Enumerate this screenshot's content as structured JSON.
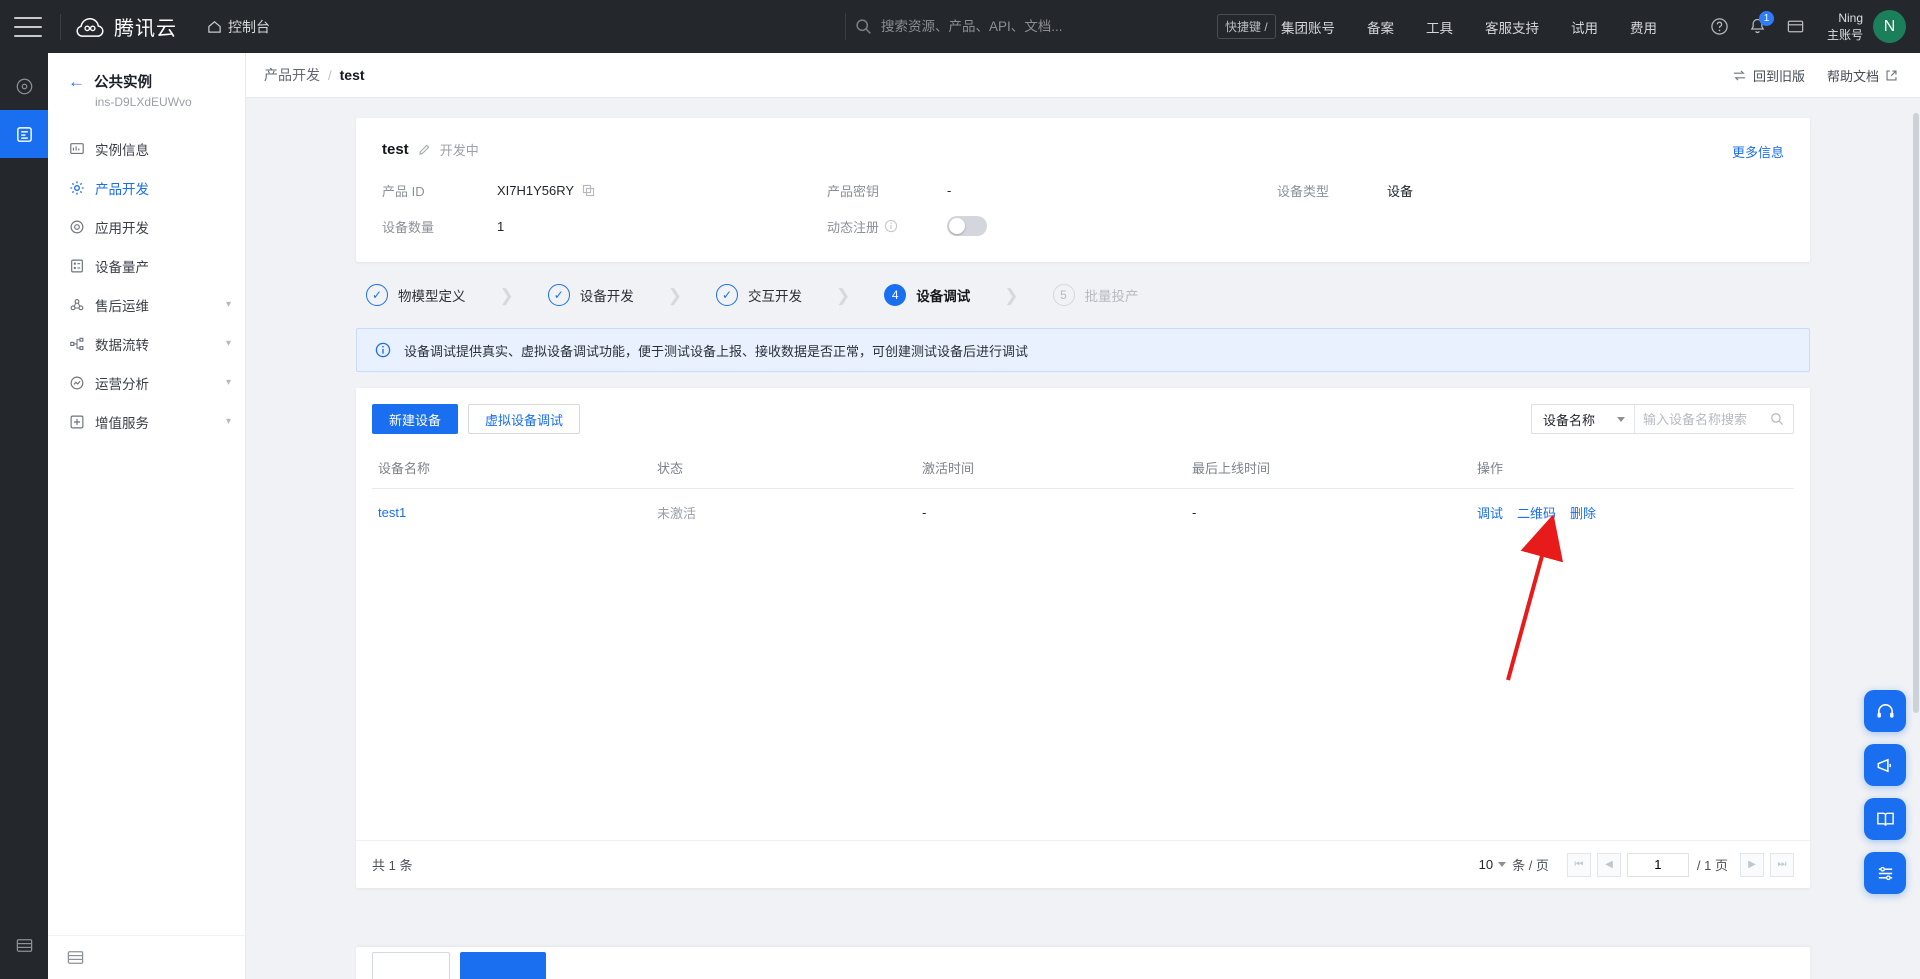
{
  "topbar": {
    "menu_icon": "hamburger-icon",
    "logo_text": "腾讯云",
    "console_label": "控制台",
    "search_placeholder": "搜索资源、产品、API、文档...",
    "kbd_hint": "快捷键 /",
    "nav": [
      {
        "label": "集团账号"
      },
      {
        "label": "备案"
      },
      {
        "label": "工具"
      },
      {
        "label": "客服支持"
      },
      {
        "label": "试用"
      },
      {
        "label": "费用"
      }
    ],
    "notification_badge": "1",
    "user_line1": "Ning",
    "user_line2": "主账号",
    "avatar_initial": "N"
  },
  "sidebar": {
    "back_label": "公共实例",
    "instance_id": "ins-D9LXdEUWvo",
    "items": [
      {
        "label": "实例信息",
        "icon": "monitor-icon",
        "expandable": false,
        "active": false
      },
      {
        "label": "产品开发",
        "icon": "gear-icon",
        "expandable": false,
        "active": true
      },
      {
        "label": "应用开发",
        "icon": "target-icon",
        "expandable": false,
        "active": false
      },
      {
        "label": "设备量产",
        "icon": "list-card-icon",
        "expandable": false,
        "active": false
      },
      {
        "label": "售后运维",
        "icon": "cloud-ops-icon",
        "expandable": true,
        "active": false
      },
      {
        "label": "数据流转",
        "icon": "sitemap-icon",
        "expandable": true,
        "active": false
      },
      {
        "label": "运营分析",
        "icon": "analytics-icon",
        "expandable": true,
        "active": false
      },
      {
        "label": "增值服务",
        "icon": "plus-service-icon",
        "expandable": true,
        "active": false
      }
    ]
  },
  "breadcrumb": {
    "parent": "产品开发",
    "separator": "/",
    "current": "test",
    "back_to_old": "回到旧版",
    "help_doc": "帮助文档"
  },
  "product_card": {
    "title": "test",
    "status": "开发中",
    "more_link": "更多信息",
    "fields": [
      {
        "key": "产品 ID",
        "value": "XI7H1Y56RY",
        "copyable": true
      },
      {
        "key": "产品密钥",
        "value": "-",
        "copyable": false
      },
      {
        "key": "设备类型",
        "value": "设备",
        "copyable": false
      },
      {
        "key": "设备数量",
        "value": "1",
        "copyable": false
      },
      {
        "key": "动态注册",
        "value": "",
        "toggle": true,
        "toggle_on": false,
        "has_help": true
      }
    ]
  },
  "steps": [
    {
      "num": "1",
      "label": "物模型定义",
      "state": "done"
    },
    {
      "num": "2",
      "label": "设备开发",
      "state": "done"
    },
    {
      "num": "3",
      "label": "交互开发",
      "state": "done"
    },
    {
      "num": "4",
      "label": "设备调试",
      "state": "active"
    },
    {
      "num": "5",
      "label": "批量投产",
      "state": "todo"
    }
  ],
  "alert": {
    "icon": "info-circle-icon",
    "text": "设备调试提供真实、虚拟设备调试功能，便于测试设备上报、接收数据是否正常，可创建测试设备后进行调试"
  },
  "toolbar": {
    "new_device": "新建设备",
    "virtual_debug": "虚拟设备调试",
    "filter_field": "设备名称",
    "search_placeholder": "输入设备名称搜索"
  },
  "table": {
    "columns": [
      "设备名称",
      "状态",
      "激活时间",
      "最后上线时间",
      "操作"
    ],
    "rows": [
      {
        "name": "test1",
        "status": "未激活",
        "activated_at": "-",
        "last_online": "-",
        "actions": [
          "调试",
          "二维码",
          "删除"
        ]
      }
    ]
  },
  "pagination": {
    "total_text": "共 1 条",
    "page_size": "10",
    "unit": "条 / 页",
    "current_page": "1",
    "total_pages": "/ 1 页"
  },
  "colors": {
    "brand_blue": "#1a6ef0",
    "header_dark": "#24272c",
    "page_bg": "#f0f2f5",
    "annotation_red": "#e81b1b"
  }
}
